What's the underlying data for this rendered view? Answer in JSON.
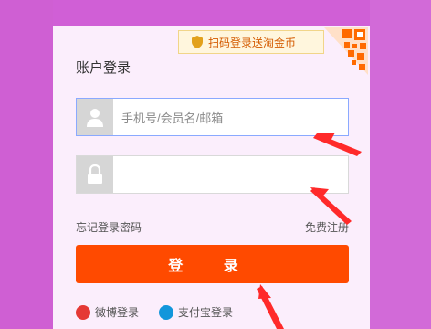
{
  "qr_tip": {
    "text": "扫码登录送淘金币"
  },
  "form": {
    "title": "账户登录",
    "username_placeholder": "手机号/会员名/邮箱",
    "password_placeholder": "",
    "forgot_password": "忘记登录密码",
    "register": "免费注册",
    "login_button": "登 录"
  },
  "oauth": {
    "weibo": "微博登录",
    "alipay": "支付宝登录"
  },
  "colors": {
    "background": "#d05fd6",
    "panel": "#fbeefc",
    "primary": "#ff4a00",
    "accent_orange": "#d45b00"
  }
}
